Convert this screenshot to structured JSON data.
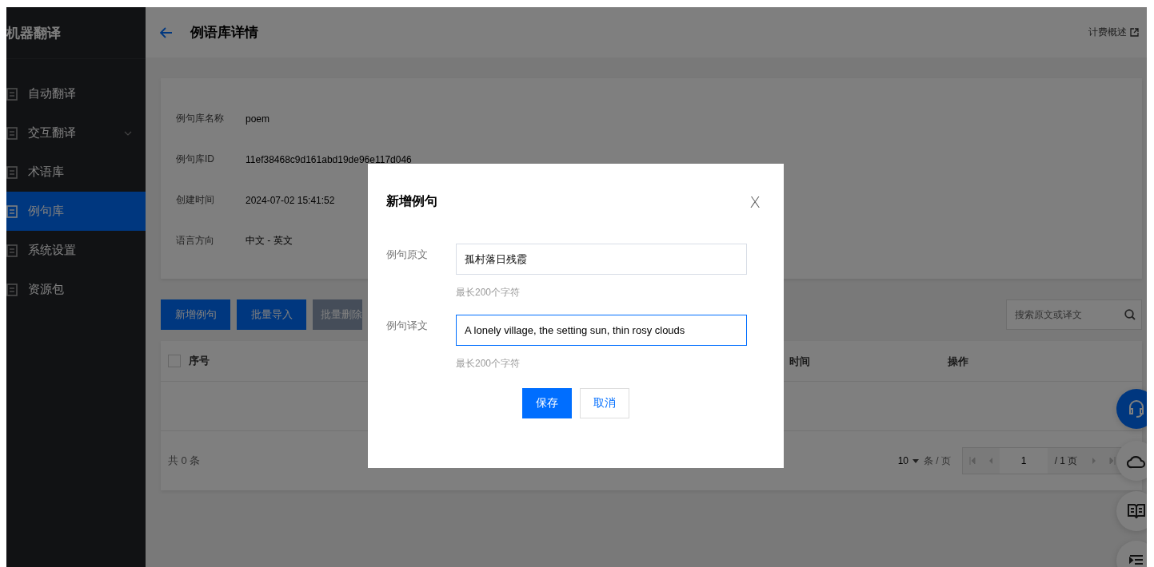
{
  "sidebar": {
    "title": "机器翻译",
    "items": [
      {
        "label": "自动翻译",
        "has_submenu": false,
        "selected": false
      },
      {
        "label": "交互翻译",
        "has_submenu": true,
        "selected": false
      },
      {
        "label": "术语库",
        "has_submenu": false,
        "selected": false
      },
      {
        "label": "例句库",
        "has_submenu": false,
        "selected": true
      },
      {
        "label": "系统设置",
        "has_submenu": false,
        "selected": false
      },
      {
        "label": "资源包",
        "has_submenu": false,
        "selected": false
      }
    ]
  },
  "header": {
    "title": "例语库详情",
    "link": "计费概述"
  },
  "details": [
    {
      "label": "例句库名称",
      "value": "poem"
    },
    {
      "label": "例句库ID",
      "value": "11ef38468c9d161abd19de96e117d046"
    },
    {
      "label": "创建时间",
      "value": "2024-07-02 15:41:52"
    },
    {
      "label": "语言方向",
      "value": "中文 - 英文"
    }
  ],
  "toolbar": {
    "buttons": [
      {
        "label": "新增例句",
        "disabled": false
      },
      {
        "label": "批量导入",
        "disabled": false
      },
      {
        "label": "批量删除",
        "disabled": true
      }
    ],
    "search": {
      "placeholder": "搜索原文或译文"
    }
  },
  "table": {
    "select_all": {
      "checked": false
    },
    "columns": [
      {
        "label": "序号"
      },
      {
        "label": "时间"
      },
      {
        "label": "操作"
      }
    ]
  },
  "footer": {
    "total": "共 0 条",
    "page_size": "10",
    "page_size_unit": "条 / 页",
    "page": "1",
    "page_total": "/ 1 页"
  },
  "modal": {
    "title": "新增例句",
    "close": "X",
    "fields": [
      {
        "label": "例句原文",
        "value": "孤村落日残霞",
        "hint": "最长200个字符",
        "focused": false
      },
      {
        "label": "例句译文",
        "value": "A lonely village, the setting sun, thin rosy clouds",
        "hint": "最长200个字符",
        "focused": true
      }
    ],
    "buttons": [
      {
        "label": "保存",
        "primary": true
      },
      {
        "label": "取消",
        "primary": false
      }
    ]
  }
}
